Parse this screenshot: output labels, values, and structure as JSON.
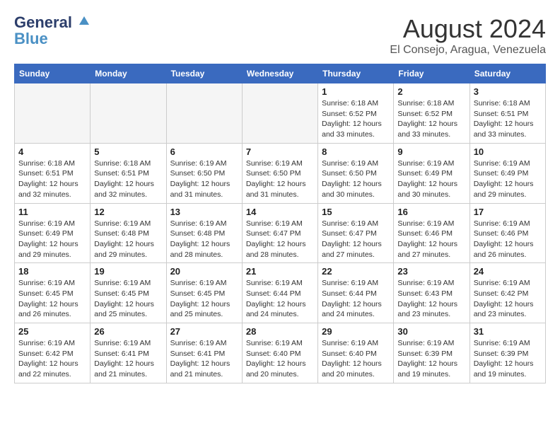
{
  "header": {
    "logo_line1": "General",
    "logo_line2": "Blue",
    "month": "August 2024",
    "location": "El Consejo, Aragua, Venezuela"
  },
  "weekdays": [
    "Sunday",
    "Monday",
    "Tuesday",
    "Wednesday",
    "Thursday",
    "Friday",
    "Saturday"
  ],
  "weeks": [
    [
      {
        "day": "",
        "info": "",
        "empty": true
      },
      {
        "day": "",
        "info": "",
        "empty": true
      },
      {
        "day": "",
        "info": "",
        "empty": true
      },
      {
        "day": "",
        "info": "",
        "empty": true
      },
      {
        "day": "1",
        "info": "Sunrise: 6:18 AM\nSunset: 6:52 PM\nDaylight: 12 hours\nand 33 minutes."
      },
      {
        "day": "2",
        "info": "Sunrise: 6:18 AM\nSunset: 6:52 PM\nDaylight: 12 hours\nand 33 minutes."
      },
      {
        "day": "3",
        "info": "Sunrise: 6:18 AM\nSunset: 6:51 PM\nDaylight: 12 hours\nand 33 minutes."
      }
    ],
    [
      {
        "day": "4",
        "info": "Sunrise: 6:18 AM\nSunset: 6:51 PM\nDaylight: 12 hours\nand 32 minutes."
      },
      {
        "day": "5",
        "info": "Sunrise: 6:18 AM\nSunset: 6:51 PM\nDaylight: 12 hours\nand 32 minutes."
      },
      {
        "day": "6",
        "info": "Sunrise: 6:19 AM\nSunset: 6:50 PM\nDaylight: 12 hours\nand 31 minutes."
      },
      {
        "day": "7",
        "info": "Sunrise: 6:19 AM\nSunset: 6:50 PM\nDaylight: 12 hours\nand 31 minutes."
      },
      {
        "day": "8",
        "info": "Sunrise: 6:19 AM\nSunset: 6:50 PM\nDaylight: 12 hours\nand 30 minutes."
      },
      {
        "day": "9",
        "info": "Sunrise: 6:19 AM\nSunset: 6:49 PM\nDaylight: 12 hours\nand 30 minutes."
      },
      {
        "day": "10",
        "info": "Sunrise: 6:19 AM\nSunset: 6:49 PM\nDaylight: 12 hours\nand 29 minutes."
      }
    ],
    [
      {
        "day": "11",
        "info": "Sunrise: 6:19 AM\nSunset: 6:49 PM\nDaylight: 12 hours\nand 29 minutes."
      },
      {
        "day": "12",
        "info": "Sunrise: 6:19 AM\nSunset: 6:48 PM\nDaylight: 12 hours\nand 29 minutes."
      },
      {
        "day": "13",
        "info": "Sunrise: 6:19 AM\nSunset: 6:48 PM\nDaylight: 12 hours\nand 28 minutes."
      },
      {
        "day": "14",
        "info": "Sunrise: 6:19 AM\nSunset: 6:47 PM\nDaylight: 12 hours\nand 28 minutes."
      },
      {
        "day": "15",
        "info": "Sunrise: 6:19 AM\nSunset: 6:47 PM\nDaylight: 12 hours\nand 27 minutes."
      },
      {
        "day": "16",
        "info": "Sunrise: 6:19 AM\nSunset: 6:46 PM\nDaylight: 12 hours\nand 27 minutes."
      },
      {
        "day": "17",
        "info": "Sunrise: 6:19 AM\nSunset: 6:46 PM\nDaylight: 12 hours\nand 26 minutes."
      }
    ],
    [
      {
        "day": "18",
        "info": "Sunrise: 6:19 AM\nSunset: 6:45 PM\nDaylight: 12 hours\nand 26 minutes."
      },
      {
        "day": "19",
        "info": "Sunrise: 6:19 AM\nSunset: 6:45 PM\nDaylight: 12 hours\nand 25 minutes."
      },
      {
        "day": "20",
        "info": "Sunrise: 6:19 AM\nSunset: 6:45 PM\nDaylight: 12 hours\nand 25 minutes."
      },
      {
        "day": "21",
        "info": "Sunrise: 6:19 AM\nSunset: 6:44 PM\nDaylight: 12 hours\nand 24 minutes."
      },
      {
        "day": "22",
        "info": "Sunrise: 6:19 AM\nSunset: 6:44 PM\nDaylight: 12 hours\nand 24 minutes."
      },
      {
        "day": "23",
        "info": "Sunrise: 6:19 AM\nSunset: 6:43 PM\nDaylight: 12 hours\nand 23 minutes."
      },
      {
        "day": "24",
        "info": "Sunrise: 6:19 AM\nSunset: 6:42 PM\nDaylight: 12 hours\nand 23 minutes."
      }
    ],
    [
      {
        "day": "25",
        "info": "Sunrise: 6:19 AM\nSunset: 6:42 PM\nDaylight: 12 hours\nand 22 minutes."
      },
      {
        "day": "26",
        "info": "Sunrise: 6:19 AM\nSunset: 6:41 PM\nDaylight: 12 hours\nand 21 minutes."
      },
      {
        "day": "27",
        "info": "Sunrise: 6:19 AM\nSunset: 6:41 PM\nDaylight: 12 hours\nand 21 minutes."
      },
      {
        "day": "28",
        "info": "Sunrise: 6:19 AM\nSunset: 6:40 PM\nDaylight: 12 hours\nand 20 minutes."
      },
      {
        "day": "29",
        "info": "Sunrise: 6:19 AM\nSunset: 6:40 PM\nDaylight: 12 hours\nand 20 minutes."
      },
      {
        "day": "30",
        "info": "Sunrise: 6:19 AM\nSunset: 6:39 PM\nDaylight: 12 hours\nand 19 minutes."
      },
      {
        "day": "31",
        "info": "Sunrise: 6:19 AM\nSunset: 6:39 PM\nDaylight: 12 hours\nand 19 minutes."
      }
    ]
  ]
}
